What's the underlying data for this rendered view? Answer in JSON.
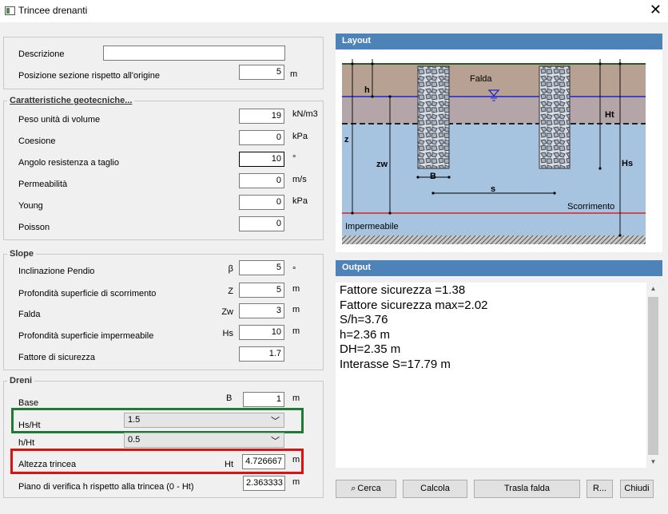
{
  "window": {
    "title": "Trincee drenanti",
    "close_glyph": "✕"
  },
  "general": {
    "descrizione_label": "Descrizione",
    "descrizione_value": "",
    "posizione_label": "Posizione sezione rispetto all'origine",
    "posizione_value": "5",
    "posizione_unit": "m"
  },
  "geotech": {
    "legend": "Caratteristiche geotecniche...",
    "rows": [
      {
        "label": "Peso unità di volume",
        "value": "19",
        "unit": "kN/m3"
      },
      {
        "label": "Coesione",
        "value": "0",
        "unit": "kPa"
      },
      {
        "label": "Angolo  resistenza a taglio",
        "value": "10",
        "unit": "°"
      },
      {
        "label": "Permeabilità",
        "value": "0",
        "unit": "m/s"
      },
      {
        "label": "Young",
        "value": "0",
        "unit": "kPa"
      },
      {
        "label": "Poisson",
        "value": "0",
        "unit": ""
      }
    ]
  },
  "slope": {
    "legend": "Slope",
    "rows": [
      {
        "label": "Inclinazione Pendio",
        "symbol": "β",
        "value": "5",
        "unit": "°"
      },
      {
        "label": "Profondità superficie di scorrimento",
        "symbol": "Z",
        "value": "5",
        "unit": "m"
      },
      {
        "label": "Falda",
        "symbol": "Zw",
        "value": "3",
        "unit": "m"
      },
      {
        "label": "Profondità superficie impermeabile",
        "symbol": "Hs",
        "value": "10",
        "unit": "m"
      },
      {
        "label": "Fattore di sicurezza",
        "symbol": "",
        "value": "1.7",
        "unit": ""
      }
    ]
  },
  "dreni": {
    "legend": "Dreni",
    "base_label": "Base",
    "base_symbol": "B",
    "base_value": "1",
    "base_unit": "m",
    "hsht_label": "Hs/Ht",
    "hsht_value": "1.5",
    "hht_label": "h/Ht",
    "hht_value": "0.5",
    "altezza_label": "Altezza trincea",
    "altezza_symbol": "Ht",
    "altezza_value": "4.726667",
    "altezza_unit": "m",
    "piano_label": "Piano di verifica h rispetto alla trincea (0 - Ht)",
    "piano_value": "2.363333",
    "piano_unit": "m"
  },
  "layout_panel": {
    "title": "Layout",
    "labels": {
      "falda": "Falda",
      "h": "h",
      "ht": "Ht",
      "z": "z",
      "zw": "zw",
      "hs": "Hs",
      "b": "B",
      "s": "s",
      "scorrimento": "Scorrimento",
      "impermeabile": "Impermeabile"
    },
    "colors": {
      "soil_top": "#b7a193",
      "soil_mid": "#b4a6a8",
      "water": "#a6c4e0",
      "water_line": "#2222cc",
      "slip_line": "#dd2222"
    }
  },
  "output_panel": {
    "title": "Output",
    "lines": [
      "Fattore sicurezza =1.38",
      "Fattore sicurezza max=2.02",
      "S/h=3.76",
      "h=2.36 m",
      "DH=2.35 m",
      "Interasse S=17.79 m"
    ]
  },
  "buttons": {
    "cerca": "Cerca",
    "calcola": "Calcola",
    "trasla": "Trasla falda",
    "r": "R...",
    "chiudi": "Chiudi"
  }
}
